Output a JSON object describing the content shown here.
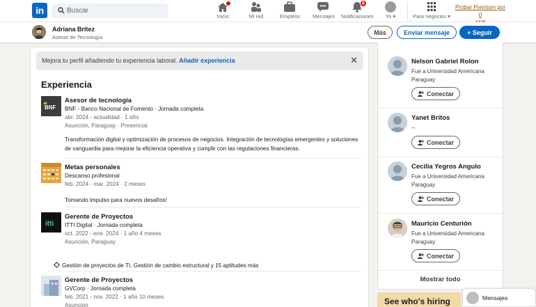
{
  "nav": {
    "logo_text": "in",
    "search_placeholder": "Buscar",
    "items": [
      {
        "label": "Inicio",
        "icon": "home-icon",
        "badge": ""
      },
      {
        "label": "Mi red",
        "icon": "network-icon",
        "badge": ""
      },
      {
        "label": "Empleos",
        "icon": "briefcase-icon",
        "badge": ""
      },
      {
        "label": "Mensajes",
        "icon": "messaging-icon",
        "badge": ""
      },
      {
        "label": "Notificaciones",
        "icon": "bell-icon",
        "badge": "6"
      },
      {
        "label": "Yo",
        "icon": "me-avatar-icon",
        "badge": ""
      },
      {
        "label": "Para negocios",
        "icon": "grid-icon",
        "badge": ""
      }
    ],
    "premium_line1": "Probar Premium por 0",
    "premium_line2": "AR$",
    "accent": "#0a66c2"
  },
  "profile_bar": {
    "name": "Adriana Britez",
    "headline": "Asesor de Tecnología",
    "btn_more": "Más",
    "btn_message": "Enviar mensaje",
    "btn_follow": "+ Seguir"
  },
  "notice": {
    "text": "Mejora tu perfil añadiendo tu experiencia laboral.",
    "link": "Añadir experiencia",
    "close": "✕"
  },
  "experience": {
    "heading": "Experiencia",
    "items": [
      {
        "title": "Asesor de tecnología",
        "company": "BNF - Banco Nacional de Fomento · Jornada completa",
        "dates": "abr. 2024 - actualidad · 1 año",
        "location": "Asunción, Paraguay · Presencial",
        "description": "Transformación digital y optimización de procesos de negocios. Integración de tecnologías emergentes y soluciones de vanguardia para mejorar la eficiencia operativa y cumplir con las regulaciones financieras.",
        "logo_text": "BNF"
      },
      {
        "title": "Metas personales",
        "company": "Descanso profesional",
        "dates": "feb. 2024 - mar. 2024 · 2 meses",
        "description": "Tomando impulso para nuevos desafíos!"
      },
      {
        "title": "Gerente de Proyectos",
        "company": "ITTI Digital · Jornada completa",
        "dates": "oct. 2022 - ene. 2024 · 1 año 4 meses",
        "location": "Asunción, Paraguay",
        "skills": "Gestión de proyectos de TI, Gestión de cambio estructural y 15 aptitudes más",
        "logo_text": "itti"
      },
      {
        "title": "Gerente de Proyectos",
        "company": "GVCorp · Jornada completa",
        "dates": "feb. 2021 - nov. 2022 · 1 año 10 meses",
        "location": "Asuncion"
      }
    ]
  },
  "sidebar": {
    "people": [
      {
        "name": "Nelson Gabriel Rolon",
        "headline": "Fue a Universidad Americana Paraguay",
        "action": "Conectar"
      },
      {
        "name": "Yanet Britos",
        "headline": "--",
        "action": "Conectar"
      },
      {
        "name": "Cecilia Yegros Angulo",
        "headline": "Fue a Universidad Americana Paraguay",
        "action": "Conectar"
      },
      {
        "name": "Mauricio Centurión",
        "headline": "Fue a Universidad Americana Paraguay",
        "action": "Conectar"
      }
    ],
    "show_all": "Mostrar todo"
  },
  "ad": {
    "text": "See who's hiring"
  },
  "messaging": {
    "label": "Mensajes"
  }
}
